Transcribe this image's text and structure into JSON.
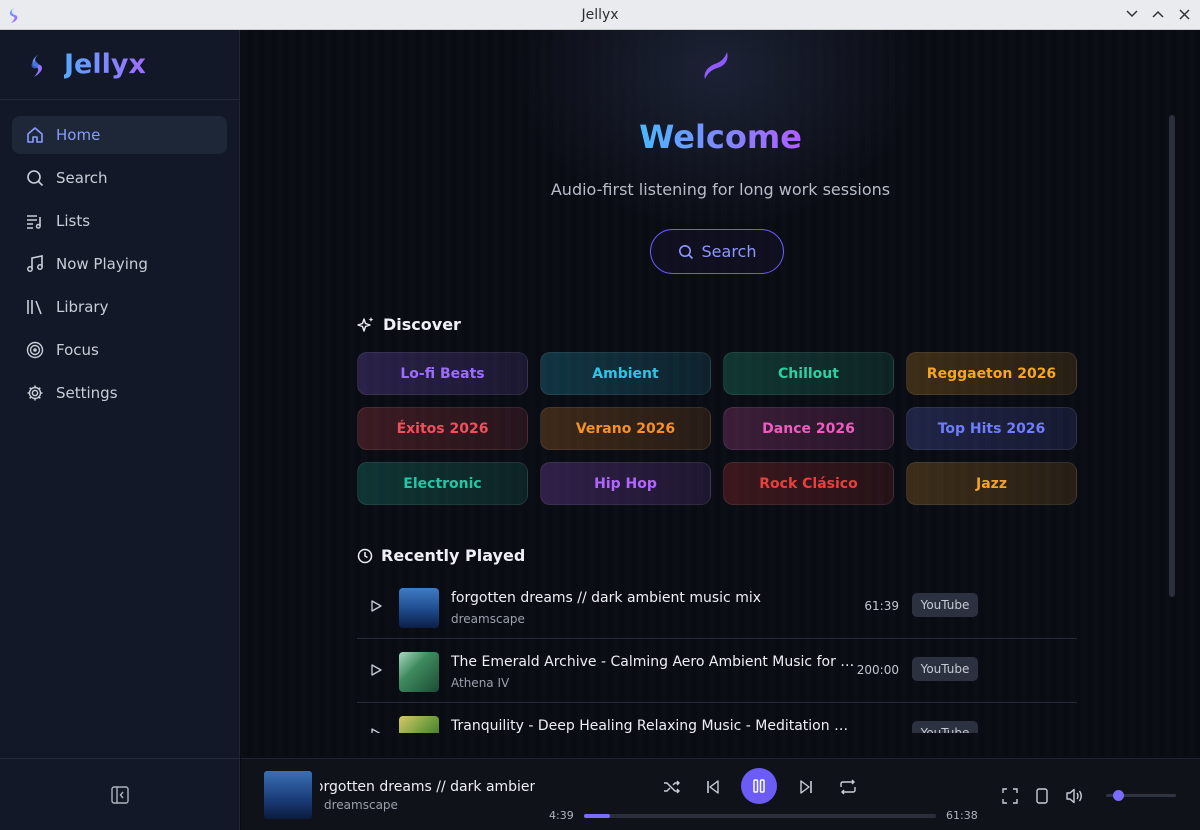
{
  "window": {
    "title": "Jellyx"
  },
  "sidebar": {
    "app_name": "Jellyx",
    "items": [
      {
        "label": "Home",
        "icon": "home-icon",
        "active": true
      },
      {
        "label": "Search",
        "icon": "search-icon"
      },
      {
        "label": "Lists",
        "icon": "list-icon"
      },
      {
        "label": "Now Playing",
        "icon": "music-note-icon"
      },
      {
        "label": "Library",
        "icon": "library-icon"
      },
      {
        "label": "Focus",
        "icon": "target-icon"
      },
      {
        "label": "Settings",
        "icon": "gear-icon"
      }
    ]
  },
  "hero": {
    "title": "Welcome",
    "subtitle": "Audio-first listening for long work sessions",
    "search_label": "Search"
  },
  "discover": {
    "title": "Discover",
    "genres": [
      {
        "label": "Lo-fi Beats",
        "color": "#9b6dff"
      },
      {
        "label": "Ambient",
        "color": "#2ec4e8"
      },
      {
        "label": "Chillout",
        "color": "#2bd0a0"
      },
      {
        "label": "Reggaeton 2026",
        "color": "#f5a623"
      },
      {
        "label": "Éxitos 2026",
        "color": "#f0505a"
      },
      {
        "label": "Verano 2026",
        "color": "#f5902a"
      },
      {
        "label": "Dance 2026",
        "color": "#f05bc0"
      },
      {
        "label": "Top Hits 2026",
        "color": "#6f7dff"
      },
      {
        "label": "Electronic",
        "color": "#22c6a4"
      },
      {
        "label": "Hip Hop",
        "color": "#b365ff"
      },
      {
        "label": "Rock Clásico",
        "color": "#e8403c"
      },
      {
        "label": "Jazz",
        "color": "#f0a32a"
      }
    ]
  },
  "recent": {
    "title": "Recently Played",
    "items": [
      {
        "title": "forgotten dreams // dark ambient music mix",
        "artist": "dreamscape",
        "duration": "61:39",
        "source": "YouTube"
      },
      {
        "title": "The Emerald Archive - Calming Aero Ambient Music for Study",
        "artist": "Athena IV",
        "duration": "200:00",
        "source": "YouTube"
      },
      {
        "title": "Tranquility - Deep Healing Relaxing Music - Meditation Ambient",
        "artist": "",
        "duration": "",
        "source": "YouTube"
      }
    ]
  },
  "player": {
    "title": "forgotten dreams // dark ambient music mix",
    "artist": "dreamscape",
    "current_time": "4:39",
    "total_time": "61:38",
    "progress": 0.075,
    "volume": 0.1
  }
}
